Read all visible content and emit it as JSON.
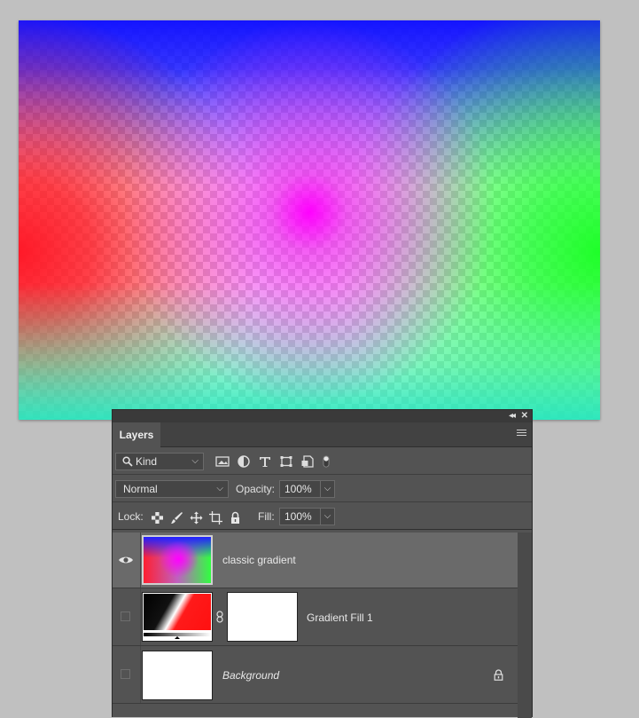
{
  "layers_panel": {
    "tab_label": "Layers",
    "filter_kind": "Kind",
    "blend_mode": "Normal",
    "opacity_label": "Opacity:",
    "opacity_value": "100%",
    "lock_label": "Lock:",
    "fill_label": "Fill:",
    "fill_value": "100%",
    "layers": [
      {
        "name": "classic gradient",
        "visible": true,
        "selected": true
      },
      {
        "name": "Gradient Fill 1",
        "visible": false,
        "selected": false
      },
      {
        "name": "Background",
        "visible": false,
        "selected": false,
        "locked": true
      }
    ]
  },
  "icons": {
    "filter_icons": [
      "image-filter-icon",
      "adjustment-filter-icon",
      "type-filter-icon",
      "shape-filter-icon",
      "smart-object-filter-icon",
      "filter-toggle-icon"
    ],
    "lock_icons": [
      "lock-transparent-pixels-icon",
      "lock-image-pixels-icon",
      "lock-position-icon",
      "lock-artboard-icon",
      "lock-all-icon"
    ]
  },
  "colors": {
    "panel_bg": "#535353",
    "selected_row": "#6a6a6a",
    "canvas_blue": "#1414ff",
    "canvas_magenta": "#ff00ff",
    "canvas_red": "#ff1928",
    "canvas_green": "#1eff28"
  }
}
